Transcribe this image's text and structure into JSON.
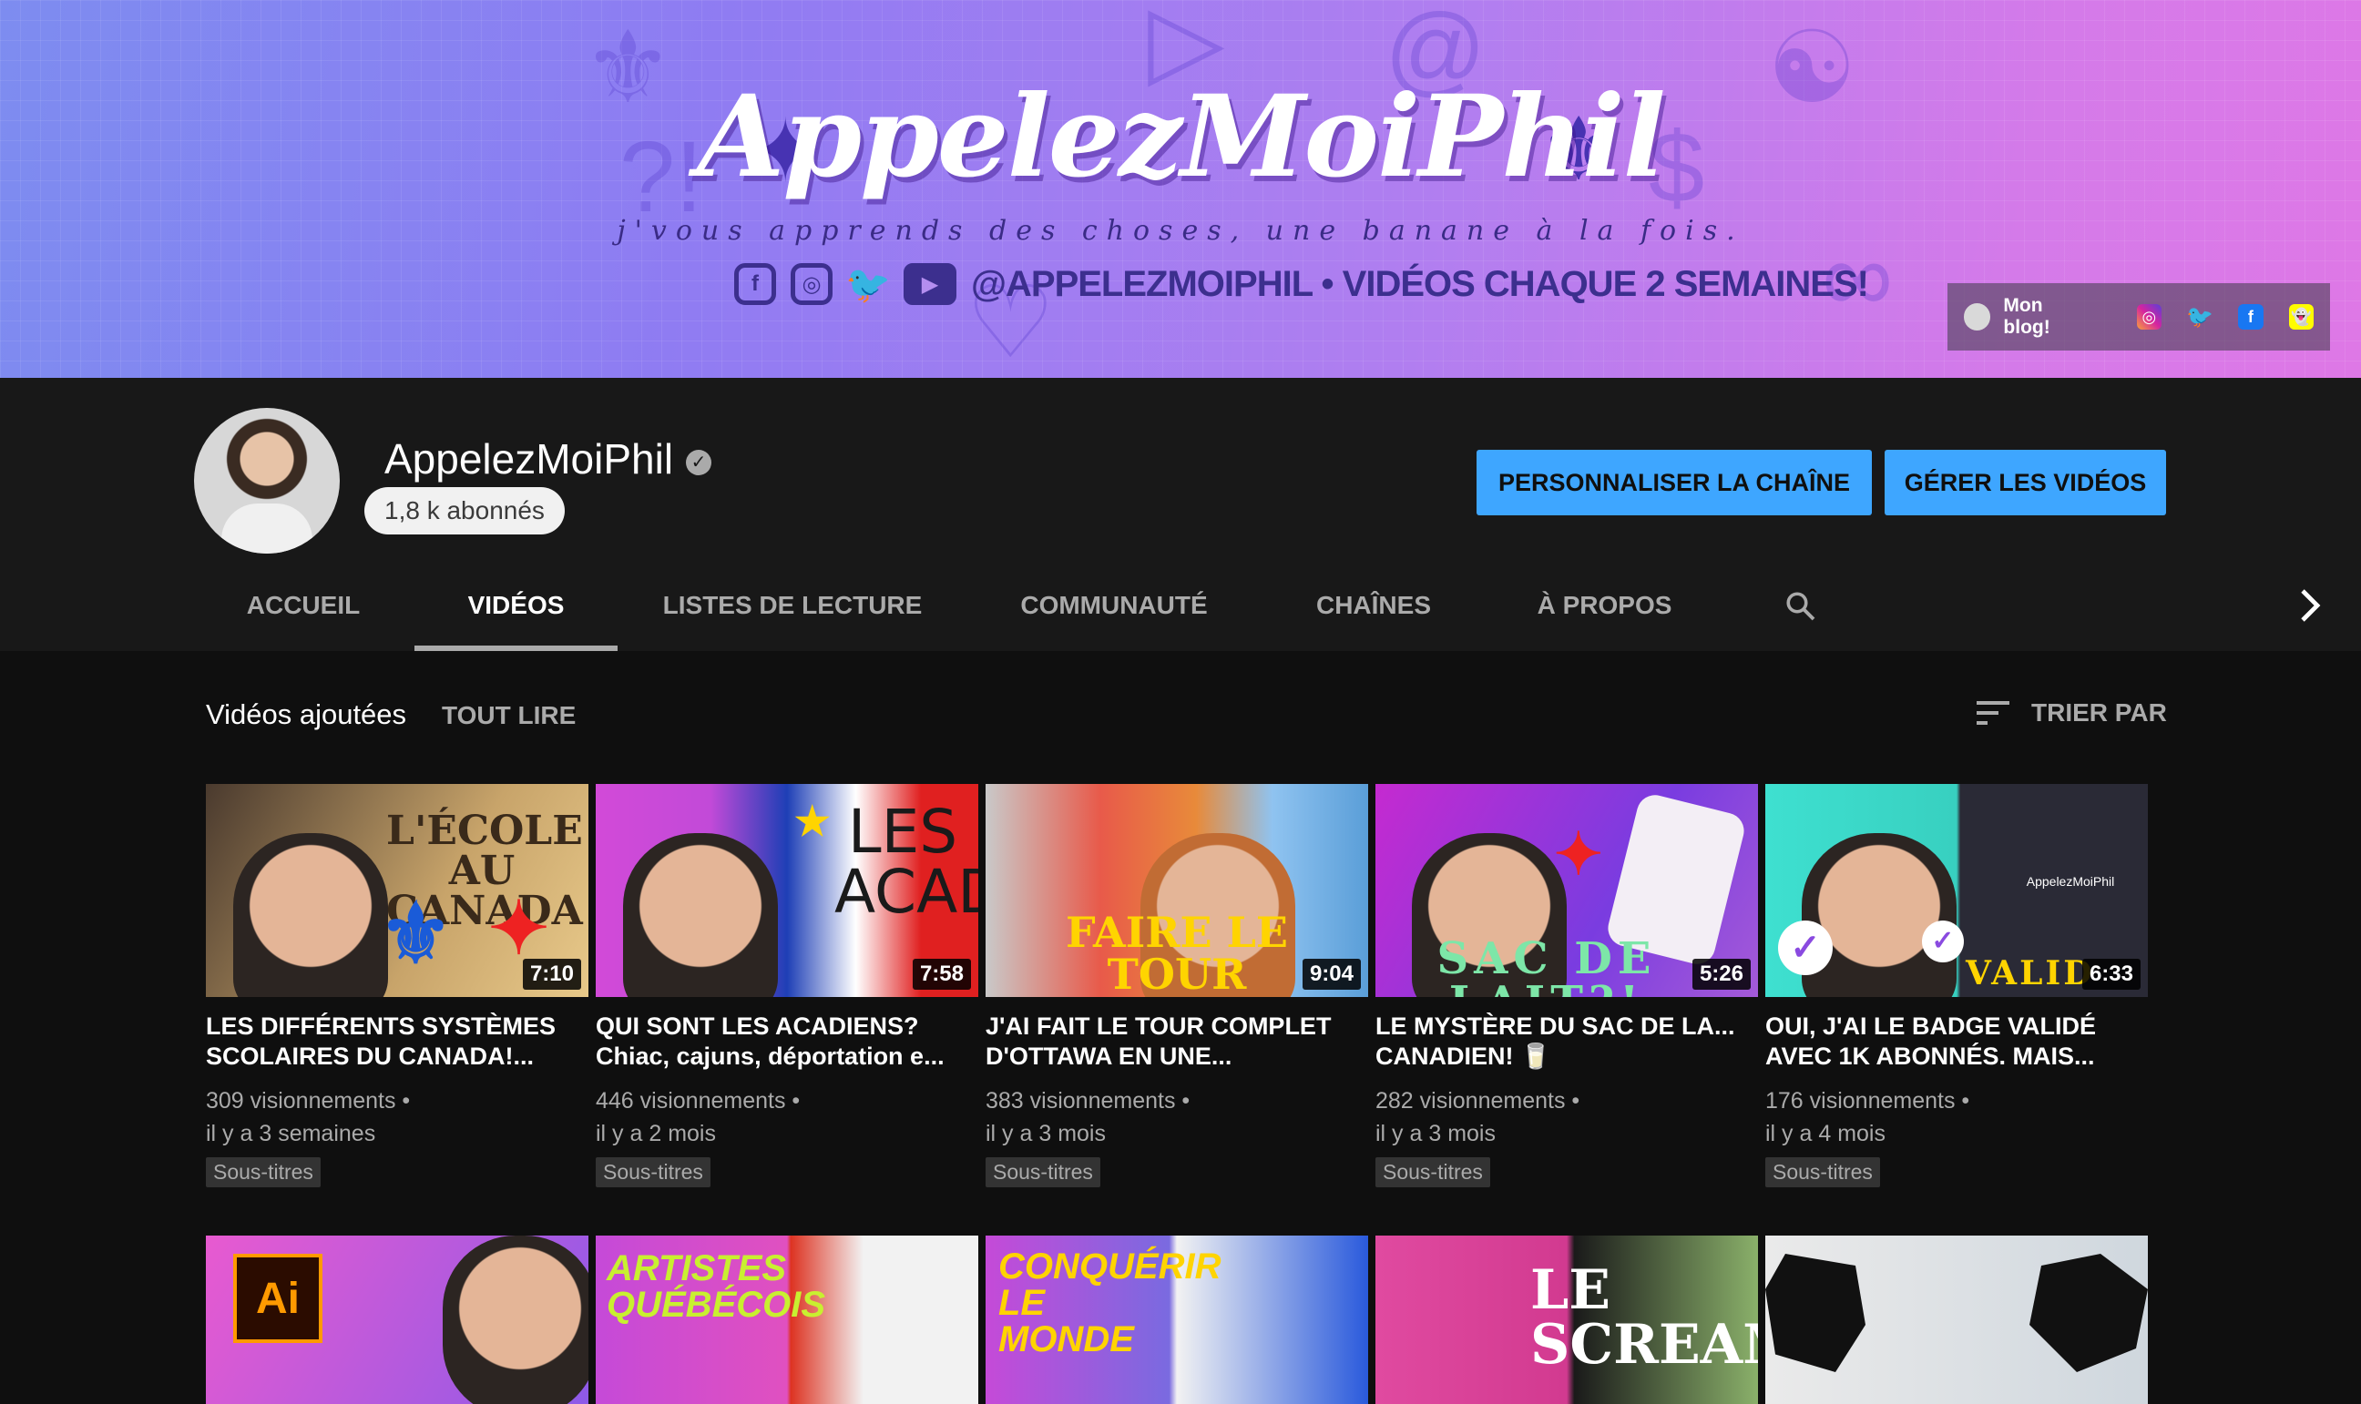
{
  "banner": {
    "title": "AppelezMoiPhil",
    "tagline": "j'vous apprends des choses, une banane à la fois.",
    "social_text": "@APPELEZMOIPHIL • VIDÉOS CHAQUE 2 SEMAINES!",
    "links_label": "Mon blog!"
  },
  "channel": {
    "name": "AppelezMoiPhil",
    "subscribers": "1,8 k abonnés",
    "customize_label": "PERSONNALISER LA CHAÎNE",
    "manage_label": "GÉRER LES VIDÉOS"
  },
  "tabs": [
    {
      "label": "ACCUEIL"
    },
    {
      "label": "VIDÉOS"
    },
    {
      "label": "LISTES DE LECTURE"
    },
    {
      "label": "COMMUNAUTÉ"
    },
    {
      "label": "CHAÎNES"
    },
    {
      "label": "À PROPOS"
    }
  ],
  "section": {
    "title": "Vidéos ajoutées",
    "play_all": "TOUT LIRE",
    "sort": "TRIER PAR"
  },
  "videos": [
    {
      "title": "LES DIFFÉRENTS SYSTÈMES SCOLAIRES DU CANADA!...",
      "views": "309 visionnements •",
      "age": "il y a 3 semaines",
      "badge": "Sous-titres",
      "duration": "7:10",
      "overlay": "L'ÉCOLE AU CANADA"
    },
    {
      "title": "QUI SONT LES ACADIENS? Chiac, cajuns, déportation e...",
      "views": "446 visionnements •",
      "age": "il y a 2 mois",
      "badge": "Sous-titres",
      "duration": "7:58",
      "overlay": "LES ACADIENS"
    },
    {
      "title": "J'AI FAIT LE TOUR COMPLET D'OTTAWA EN UNE...",
      "views": "383 visionnements •",
      "age": "il y a 3 mois",
      "badge": "Sous-titres",
      "duration": "9:04",
      "overlay": "FAIRE LE TOUR D'OTTAWA"
    },
    {
      "title": "LE MYSTÈRE DU SAC DE LA... CANADIEN! 🥛",
      "views": "282 visionnements •",
      "age": "il y a 3 mois",
      "badge": "Sous-titres",
      "duration": "5:26",
      "overlay": "SAC DE LAIT?!"
    },
    {
      "title": "OUI, J'AI LE BADGE VALIDÉ AVEC 1K ABONNÉS. MAIS...",
      "views": "176 visionnements •",
      "age": "il y a 4 mois",
      "badge": "Sous-titres",
      "duration": "6:33",
      "overlay": "VALID"
    }
  ],
  "row2_overlays": [
    "Ai",
    "ARTISTES QUÉBÉCOIS",
    "CONQUÉRIR LE MONDE",
    "LE SCREAMER",
    ""
  ],
  "colors": {
    "background": "#0f0f0f",
    "header": "#181818",
    "accent_button": "#3ea6ff",
    "muted_text": "#aaaaaa"
  }
}
